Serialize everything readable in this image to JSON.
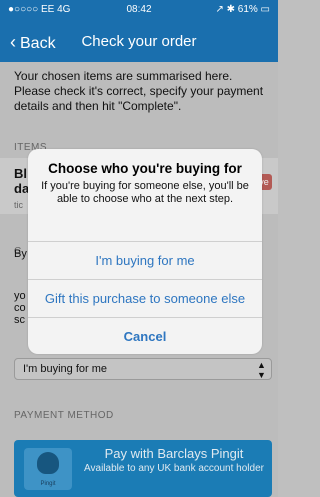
{
  "status_bar": {
    "carrier": "●○○○○ EE  4G",
    "time": "08:42",
    "indicators": "↗ ✱ 61% ▭"
  },
  "nav": {
    "back_label": "Back",
    "title": "Check your order"
  },
  "intro_text": "Your chosen items are summarised here. Please check it's correct, specify your payment details and then hit \"Complete\".",
  "items_section": {
    "label": "ITEMS",
    "item_name_partial": "Bl",
    "item_name_partial_2": "da",
    "item_sub_partial": "tic",
    "item_badge_partial": "ve"
  },
  "recipient_section": {
    "label_partial": "C",
    "body_partial_lines": [
      "By",
      "yo",
      "co",
      "sc"
    ],
    "selected_value": "I'm buying for me"
  },
  "payment_section": {
    "label": "PAYMENT METHOD",
    "pingit_title": "Pay with Barclays Pingit",
    "pingit_subtitle": "Available to any UK bank account holder",
    "pingit_logo_label": "Pingit"
  },
  "dialog": {
    "title": "Choose who you're buying for",
    "message": "If you're buying for someone else, you'll be able to choose who at the next step.",
    "buttons": [
      {
        "label": "I'm buying for me"
      },
      {
        "label": "Gift this purchase to someone else"
      },
      {
        "label": "Cancel"
      }
    ]
  },
  "colors": {
    "nav_bar": "#1a6fae",
    "dialog_button_text": "#2e76c0",
    "pingit_button": "#1b7cb5"
  }
}
